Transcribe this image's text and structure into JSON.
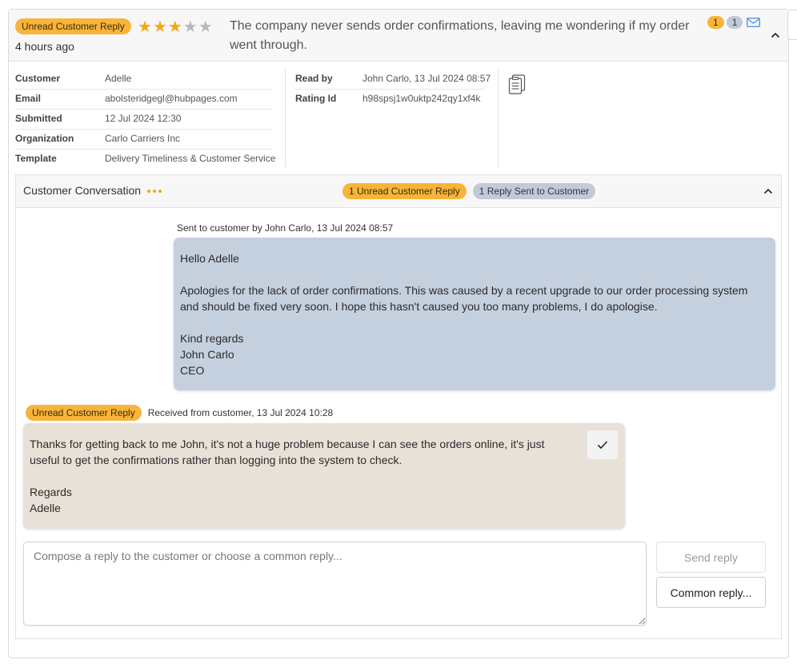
{
  "header": {
    "status_badge": "Unread Customer Reply",
    "time_ago": "4 hours ago",
    "rating": {
      "value": 3,
      "max": 5
    },
    "comment": "The company never sends order confirmations, leaving me wondering if my order went through.",
    "unread_count": "1",
    "sent_count": "1",
    "icons": {
      "mail": "mail-icon",
      "collapse": "chevron-up-icon"
    }
  },
  "details": {
    "left": [
      {
        "key": "Customer",
        "value": "Adelle"
      },
      {
        "key": "Email",
        "value": "abolsteridgegl@hubpages.com"
      },
      {
        "key": "Submitted",
        "value": "12 Jul 2024 12:30"
      },
      {
        "key": "Organization",
        "value": "Carlo Carriers Inc"
      },
      {
        "key": "Template",
        "value": "Delivery Timeliness & Customer Service"
      }
    ],
    "right": [
      {
        "key": "Read by",
        "value": "John Carlo, 13 Jul 2024 08:57"
      },
      {
        "key": "Rating Id",
        "value": "h98spsj1w0uktp242qy1xf4k"
      }
    ],
    "copy_icon": "clipboard-icon"
  },
  "conversation": {
    "title": "Customer Conversation",
    "unread_badge": "1 Unread Customer Reply",
    "sent_badge": "1 Reply Sent to Customer",
    "messages": [
      {
        "direction": "sent",
        "meta": "Sent to customer by John Carlo, 13 Jul 2024 08:57",
        "body": "Hello Adelle\n\nApologies for the lack of order confirmations. This was caused by a recent upgrade to our order processing system and should be fixed very soon. I hope this hasn't caused you too many problems, I do apologise.\n\nKind regards\nJohn Carlo\nCEO"
      },
      {
        "direction": "received",
        "badge": "Unread Customer Reply",
        "meta": "Received from customer, 13 Jul 2024 10:28",
        "body": "Thanks for getting back to me John, it's not a huge problem because I can see the orders online, it's just useful to get the confirmations rather than logging into the system to check.\n\nRegards\nAdelle"
      }
    ],
    "reply": {
      "placeholder": "Compose a reply to the customer or choose a common reply...",
      "value": "",
      "send_label": "Send reply",
      "common_label": "Common reply..."
    }
  },
  "colors": {
    "accent_orange": "#f8b43a",
    "pill_gray": "#c1cad6",
    "sent_bubble": "#c5d0df",
    "received_bubble": "#e8e1d8",
    "star": "#f3a81b"
  }
}
